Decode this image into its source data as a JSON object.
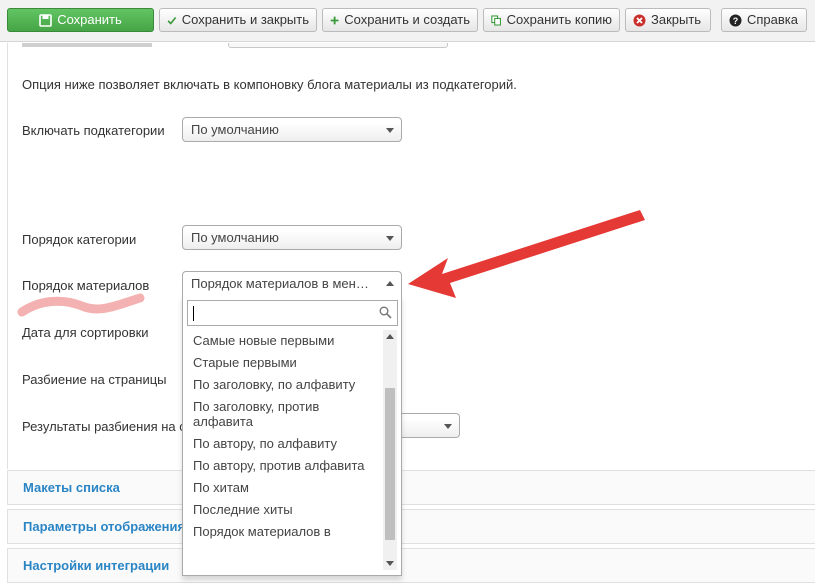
{
  "toolbar": {
    "save": "Сохранить",
    "save_close": "Сохранить и закрыть",
    "save_new": "Сохранить и создать",
    "save_copy": "Сохранить копию",
    "close": "Закрыть",
    "help": "Справка"
  },
  "form": {
    "info_text": "Опция ниже позволяет включать в компоновку блога материалы из подкатегорий.",
    "fields": [
      {
        "label": "Включать подкатегории",
        "value": "По умолчанию"
      },
      {
        "label": "Порядок категории",
        "value": "По умолчанию"
      },
      {
        "label": "Порядок материалов",
        "value": "Порядок материалов в менеджере"
      },
      {
        "label": "Дата для сортировки"
      },
      {
        "label": "Разбиение на страницы"
      },
      {
        "label": "Результаты разбиения на страницы"
      }
    ]
  },
  "dropdown": {
    "search_value": "",
    "options": [
      "Самые новые первыми",
      "Старые первыми",
      "По заголовку, по алфавиту",
      "По заголовку, против алфавита",
      "По автору, по алфавиту",
      "По автору, против алфавита",
      "По хитам",
      "Последние хиты",
      "Порядок материалов в"
    ]
  },
  "panels": [
    {
      "title": "Макеты списка"
    },
    {
      "title": "Параметры отображения"
    },
    {
      "title": "Настройки интеграции"
    }
  ],
  "colors": {
    "primary_button": "#46a546",
    "panel_link": "#2a85c5",
    "annotation_arrow": "#e53935",
    "annotation_scribble": "#f2a3a3"
  }
}
